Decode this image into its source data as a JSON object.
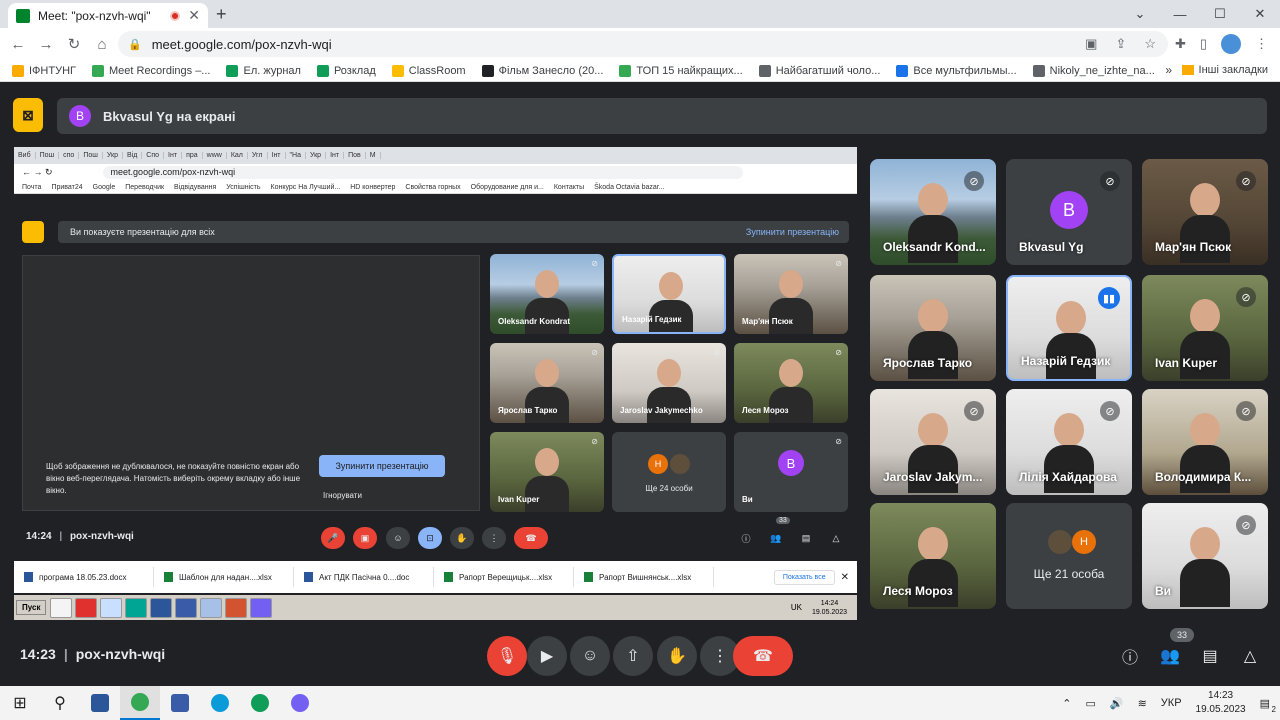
{
  "browser": {
    "tab_title": "Meet: \"pox-nzvh-wqi\"",
    "url": "meet.google.com/pox-nzvh-wqi",
    "bookmarks": [
      {
        "label": "ІФНТУНГ",
        "color": "#f9ab00"
      },
      {
        "label": "Meet Recordings –...",
        "color": "#34a853"
      },
      {
        "label": "Ел. журнал",
        "color": "#0f9d58"
      },
      {
        "label": "Розклад",
        "color": "#0f9d58"
      },
      {
        "label": "ClassRoom",
        "color": "#fbbc04"
      },
      {
        "label": "Фільм Занесло (20...",
        "color": "#202124"
      },
      {
        "label": "ТОП 15 найкращих...",
        "color": "#34a853"
      },
      {
        "label": "Найбагатший чоло...",
        "color": "#5f6368"
      },
      {
        "label": "Все мультфильмы...",
        "color": "#1a73e8"
      },
      {
        "label": "Nikoly_ne_izhte_na...",
        "color": "#5f6368"
      }
    ],
    "more_bookmarks": "»",
    "other_bookmarks": "Інші закладки"
  },
  "meet": {
    "presenter_initial": "B",
    "presenter_banner": "Bkvasul Yg на екрані",
    "time": "14:23",
    "meeting_code": "pox-nzvh-wqi",
    "participant_count": "33",
    "accent": "#8ab4f8",
    "hangup_color": "#ea4335"
  },
  "shared_screen": {
    "tabs": [
      "Виб",
      "Пош",
      "спо",
      "Пош",
      "Укр",
      "Від",
      "Спо",
      "Інт",
      "пра",
      "www",
      "Кал",
      "Угл",
      "Інт",
      "\"На",
      "Укр",
      "Інт",
      "Пов",
      "M"
    ],
    "url": "meet.google.com/pox-nzvh-wqi",
    "bookmarks": [
      "Почта",
      "Приват24",
      "Google",
      "Переводчик",
      "Відвідування",
      "Успішність",
      "Конкурс На Лучший...",
      "HD конвертер",
      "Свойства горных",
      "Оборудование для и...",
      "Контакты",
      "Škoda Octavia bazar..."
    ],
    "presenting_text": "Ви показуєте презентацію для всіх",
    "stop_presenting_link": "Зупинити презентацію",
    "notice": "Щоб зображення не дублювалося, не показуйте повністю екран або вікно веб-переглядача. Натомість виберіть окрему вкладку або інше вікно.",
    "stop_button": "Зупинити презентацію",
    "ignore": "Ігнорувати",
    "tiles": [
      {
        "name": "Oleksandr Kondrat",
        "bg": "bg-mtn"
      },
      {
        "name": "Назарій Гедзик",
        "bg": "bg-wall"
      },
      {
        "name": "Мар'ян Псюк",
        "bg": "bg-window"
      },
      {
        "name": "Ярослав Тарко",
        "bg": "bg-window"
      },
      {
        "name": "Jaroslav Jakymechko",
        "bg": "bg-office"
      },
      {
        "name": "Леся Мороз",
        "bg": "bg-green"
      },
      {
        "name": "Ivan Kuper",
        "bg": "bg-green"
      },
      {
        "name": "Ще 24 особи",
        "bg": ""
      },
      {
        "name": "Ви",
        "bg": ""
      }
    ],
    "more_initial": "H",
    "you_initial": "B",
    "time": "14:24",
    "meeting_code": "pox-nzvh-wqi",
    "participant_count": "33",
    "downloads": [
      "програма 18.05.23.docx",
      "Шаблон для надан....xlsx",
      "Акт ПДК Пасічна 0....doc",
      "Рапорт Верещицьк....xlsx",
      "Рапорт Вишнянськ....xlsx"
    ],
    "show_all": "Показать все",
    "start": "Пуск",
    "lang": "UK",
    "tray_time": "14:24",
    "tray_date": "19.05.2023"
  },
  "participants": [
    {
      "name": "Oleksandr Kond...",
      "bg": "bg-mtn",
      "muted": true
    },
    {
      "name": "Bkvasul Yg",
      "initial": "B",
      "muted": true
    },
    {
      "name": "Мар'ян Псюк",
      "bg": "bg-brown",
      "muted": true
    },
    {
      "name": "Ярослав Тарко",
      "bg": "bg-window",
      "muted": false
    },
    {
      "name": "Назарій Гедзик",
      "bg": "bg-wall",
      "speaking": true
    },
    {
      "name": "Ivan Kuper",
      "bg": "bg-green",
      "muted": true
    },
    {
      "name": "Jaroslav Jakym...",
      "bg": "bg-office",
      "muted": true
    },
    {
      "name": "Лілія Хайдарова",
      "bg": "bg-wall",
      "muted": true
    },
    {
      "name": "Володимира К...",
      "bg": "bg-room",
      "muted": true
    },
    {
      "name": "Леся Мороз",
      "bg": "bg-green",
      "muted": false
    },
    {
      "name": "Ще 21 особа",
      "more": true
    },
    {
      "name": "Ви",
      "bg": "bg-wall",
      "muted": true
    }
  ],
  "more_initial": "H",
  "taskbar": {
    "lang": "УКР",
    "time": "14:23",
    "date": "19.05.2023",
    "notifications": "2"
  }
}
